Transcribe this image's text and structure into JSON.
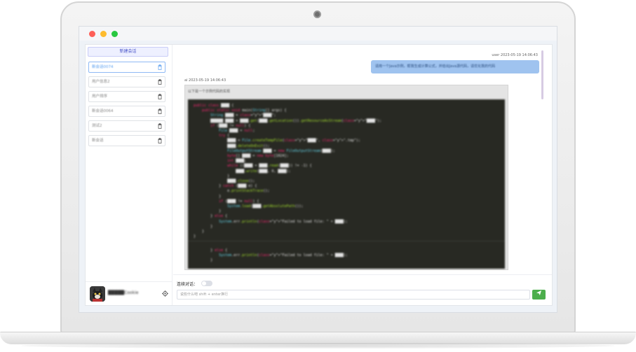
{
  "sidebar": {
    "new_chat_label": "新建会话",
    "conversations": [
      {
        "label": "新会话0074",
        "active": true
      },
      {
        "label": "用户信息2",
        "active": false
      },
      {
        "label": "用户排序",
        "active": false
      },
      {
        "label": "新会话0064",
        "active": false
      },
      {
        "label": "测试2",
        "active": false
      },
      {
        "label": "新会话",
        "active": false
      }
    ],
    "username": "█████Cookie"
  },
  "chat": {
    "user_meta": "user 2023-05-19 14:06:43",
    "user_message": "请用一个Java示例，帮我生成计算公式，并给出Java源代码，请优化我的代码",
    "ai_meta": "ai 2023-05-19 14:06:43",
    "ai_intro": "以下是一个示例代码的实现",
    "code_lines": [
      "public class ████ {",
      "    public static void main(String[] args) {",
      "        String ████ = \"████\";",
      "        ██████ ████ = ████.get(████.getLocation()).getResourceAsStream(\"████\");",
      "        if (████ != null) {",
      "            File ████ = null;",
      "            try {",
      "                ████ = File.createTempFile(\"████\", \".tmp\");",
      "                ████.deleteOnExit();",
      "                FileOutputStream ████ = new FileOutputStream(████);",
      "                byte[] ████ = new byte[1024];",
      "                int ████;",
      "                while ((████ = ████.read(████)) != -1) {",
      "                    ████.write(████, 0, ████);",
      "                }",
      "                ████.close();",
      "            } catch (████ e) {",
      "                e.printStackTrace();",
      "            }",
      "            if (████ != null) {",
      "                System.load(████.getAbsolutePath());",
      "            }",
      "        } else {",
      "            System.err.println(\"Failed to load file: \" + ████);",
      "        }",
      "    }",
      "}",
      "",
      "        } else {",
      "            System.err.println(\"Failed to load file: \" + ████);",
      "        }"
    ]
  },
  "input": {
    "continuous_label": "连续对话：",
    "placeholder": "说些什么吧 shift + enter换行",
    "send_icon": "send-icon"
  }
}
